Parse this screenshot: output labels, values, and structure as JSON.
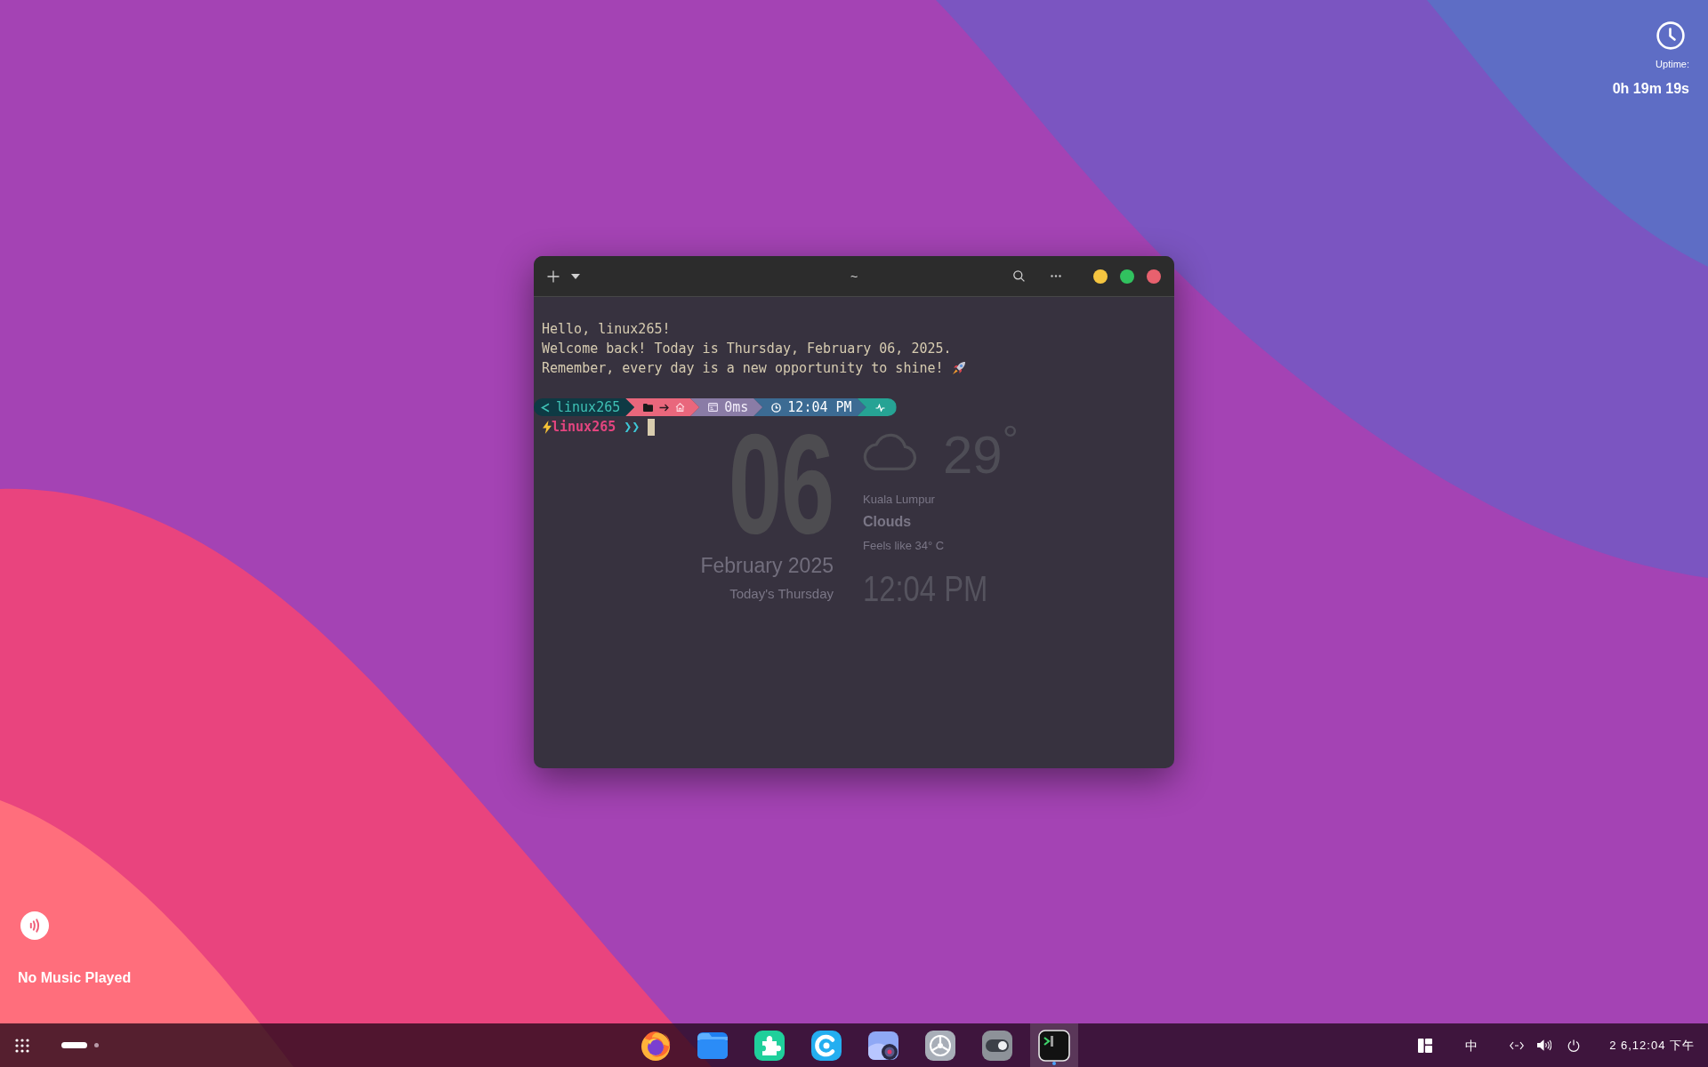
{
  "uptime": {
    "label": "Uptime:",
    "value": "0h 19m 19s"
  },
  "terminal": {
    "title": "~",
    "output": [
      "Hello, linux265!",
      "Welcome back! Today is Thursday, February 06, 2025.",
      "Remember, every day is a new opportunity to shine!"
    ],
    "prompt": [
      {
        "kind": "user",
        "text": "linux265",
        "color": "#0e3a44"
      },
      {
        "kind": "path",
        "color": "#e9677c"
      },
      {
        "kind": "duration",
        "text": "0ms",
        "color": "#8a7ca6"
      },
      {
        "kind": "time",
        "text": "12:04 PM",
        "color": "#3c6b93"
      },
      {
        "kind": "status",
        "color": "#26a394"
      }
    ],
    "input": {
      "user": "linux265",
      "symbol": "❯❯"
    }
  },
  "date_widget": {
    "day": "06",
    "month_year": "February 2025",
    "weekday": "Today's Thursday"
  },
  "weather_widget": {
    "temperature": "29$^{°}$",
    "location": "Kuala Lumpur",
    "condition": "Clouds",
    "feels_like": "Feels like 34° C",
    "time": "12:04 PM"
  },
  "music": {
    "status": "No Music Played"
  },
  "taskbar": {
    "workspaces": [
      {
        "selected": true
      },
      {
        "selected": false
      }
    ],
    "dock": [
      {
        "kind": "browser",
        "active": false
      },
      {
        "kind": "files",
        "active": false
      },
      {
        "kind": "extensions",
        "active": false
      },
      {
        "kind": "c_app",
        "active": false
      },
      {
        "kind": "camera",
        "active": false
      },
      {
        "kind": "settings",
        "active": false
      },
      {
        "kind": "toggle",
        "active": false
      },
      {
        "kind": "terminal",
        "active": true
      }
    ],
    "input_method": "中",
    "clock": "2 6,12:04 下午"
  }
}
